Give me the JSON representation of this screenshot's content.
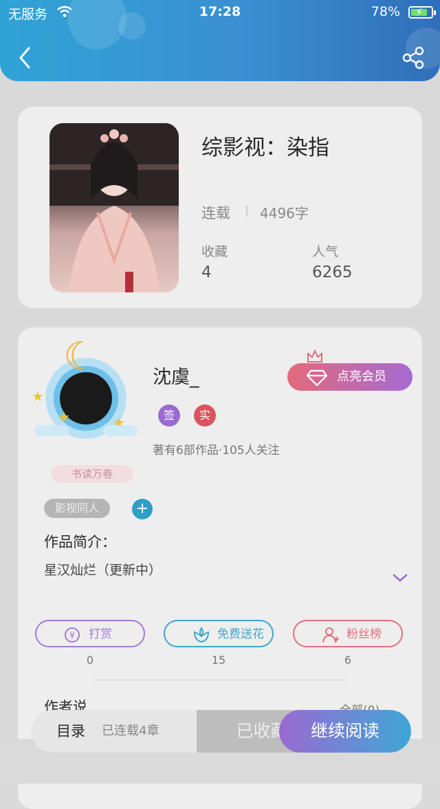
{
  "status_bar": {
    "carrier": "无服务",
    "time": "17:28",
    "battery": "78%",
    "battery_level": 0.78
  },
  "book": {
    "title": "综影视：染指",
    "status": "连载",
    "word_count": "4496字",
    "favorites_label": "收藏",
    "favorites_value": "4",
    "popularity_label": "人气",
    "popularity_value": "6265"
  },
  "author": {
    "name": "沈虞_",
    "vip_button": "点亮会员",
    "badge_sign": "签",
    "badge_real": "实",
    "works_info": "著有6部作品·105人关注",
    "reader_badge": "书读万卷"
  },
  "genre_tag": "影视同人",
  "intro": {
    "title": "作品简介：",
    "text": "星汉灿烂（更新中）"
  },
  "actions": [
    {
      "label": "打赏",
      "count": "0",
      "color": "#a27bd6"
    },
    {
      "label": "免费送花",
      "count": "15",
      "color": "#3ba7cc"
    },
    {
      "label": "粉丝榜",
      "count": "6",
      "color": "#e2707b"
    }
  ],
  "author_says": {
    "title": "作者说",
    "all_link": "全部(0)"
  },
  "bottom_bar": {
    "toc_label": "目录",
    "toc_count": "已连载4章",
    "collected": "已收藏",
    "continue": "继续阅读"
  }
}
